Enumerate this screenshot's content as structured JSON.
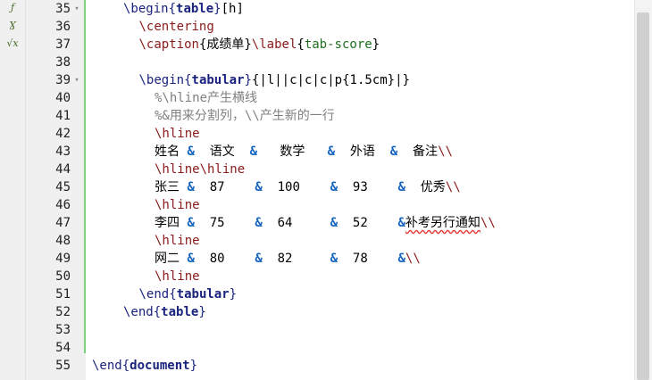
{
  "left_bar": {
    "icons": [
      {
        "name": "lambda-icon",
        "glyph": "ƒ"
      },
      {
        "name": "greek-icon",
        "glyph": "Ɣ"
      },
      {
        "name": "sqrt-icon",
        "glyph": "√x"
      }
    ]
  },
  "lines": [
    {
      "num": "35",
      "indent": 2,
      "fold": true,
      "tokens": [
        [
          "kw",
          "\\begin{"
        ],
        [
          "arg",
          "table"
        ],
        [
          "kw",
          "}"
        ],
        [
          "txt",
          "[h]"
        ]
      ]
    },
    {
      "num": "36",
      "indent": 3,
      "fold": false,
      "tokens": [
        [
          "cmd",
          "\\centering"
        ]
      ]
    },
    {
      "num": "37",
      "indent": 3,
      "fold": false,
      "tokens": [
        [
          "cmd",
          "\\caption"
        ],
        [
          "txt",
          "{成绩单}"
        ],
        [
          "cmd",
          "\\label"
        ],
        [
          "txt",
          "{"
        ],
        [
          "lbl",
          "tab-score"
        ],
        [
          "txt",
          "}"
        ]
      ]
    },
    {
      "num": "38",
      "indent": 0,
      "fold": false,
      "tokens": []
    },
    {
      "num": "39",
      "indent": 3,
      "fold": true,
      "tokens": [
        [
          "kw",
          "\\begin{"
        ],
        [
          "arg",
          "tabular"
        ],
        [
          "kw",
          "}"
        ],
        [
          "txt",
          "{|l||c|c|c|p{1.5cm}|}"
        ]
      ]
    },
    {
      "num": "40",
      "indent": 4,
      "fold": false,
      "tokens": [
        [
          "cmt",
          "%\\hline产生横线"
        ]
      ]
    },
    {
      "num": "41",
      "indent": 4,
      "fold": false,
      "tokens": [
        [
          "cmt",
          "%&用来分割列，\\\\产生新的一行"
        ]
      ]
    },
    {
      "num": "42",
      "indent": 4,
      "fold": false,
      "tokens": [
        [
          "cmd",
          "\\hline"
        ]
      ]
    },
    {
      "num": "43",
      "indent": 4,
      "fold": false,
      "tokens": [
        [
          "txt",
          "姓名 "
        ],
        [
          "amp",
          "&"
        ],
        [
          "txt",
          "  语文  "
        ],
        [
          "amp",
          "&"
        ],
        [
          "txt",
          "   数学   "
        ],
        [
          "amp",
          "&"
        ],
        [
          "txt",
          "  外语  "
        ],
        [
          "amp",
          "&"
        ],
        [
          "txt",
          "  备注"
        ],
        [
          "cmd",
          "\\\\"
        ]
      ]
    },
    {
      "num": "44",
      "indent": 4,
      "fold": false,
      "tokens": [
        [
          "cmd",
          "\\hline\\hline"
        ]
      ]
    },
    {
      "num": "45",
      "indent": 4,
      "fold": false,
      "tokens": [
        [
          "txt",
          "张三 "
        ],
        [
          "amp",
          "&"
        ],
        [
          "txt",
          "  87    "
        ],
        [
          "amp",
          "&"
        ],
        [
          "txt",
          "  100    "
        ],
        [
          "amp",
          "&"
        ],
        [
          "txt",
          "  93    "
        ],
        [
          "amp",
          "&"
        ],
        [
          "txt",
          "  优秀"
        ],
        [
          "cmd",
          "\\\\"
        ]
      ]
    },
    {
      "num": "46",
      "indent": 4,
      "fold": false,
      "tokens": [
        [
          "cmd",
          "\\hline"
        ]
      ]
    },
    {
      "num": "47",
      "indent": 4,
      "fold": false,
      "tokens": [
        [
          "txt",
          "李四 "
        ],
        [
          "amp",
          "&"
        ],
        [
          "txt",
          "  75    "
        ],
        [
          "amp",
          "&"
        ],
        [
          "txt",
          "  64     "
        ],
        [
          "amp",
          "&"
        ],
        [
          "txt",
          "  52    "
        ],
        [
          "amp",
          "&"
        ],
        [
          "sq",
          "补考另行通知"
        ],
        [
          "cmd",
          "\\\\"
        ]
      ]
    },
    {
      "num": "48",
      "indent": 4,
      "fold": false,
      "tokens": [
        [
          "cmd",
          "\\hline"
        ]
      ]
    },
    {
      "num": "49",
      "indent": 4,
      "fold": false,
      "tokens": [
        [
          "txt",
          "网二 "
        ],
        [
          "amp",
          "&"
        ],
        [
          "txt",
          "  80    "
        ],
        [
          "amp",
          "&"
        ],
        [
          "txt",
          "  82     "
        ],
        [
          "amp",
          "&"
        ],
        [
          "txt",
          "  78    "
        ],
        [
          "amp",
          "&"
        ],
        [
          "cmd",
          "\\\\"
        ]
      ]
    },
    {
      "num": "50",
      "indent": 4,
      "fold": false,
      "tokens": [
        [
          "cmd",
          "\\hline"
        ]
      ]
    },
    {
      "num": "51",
      "indent": 3,
      "fold": false,
      "tokens": [
        [
          "kw",
          "\\end{"
        ],
        [
          "arg",
          "tabular"
        ],
        [
          "kw",
          "}"
        ]
      ]
    },
    {
      "num": "52",
      "indent": 2,
      "fold": false,
      "tokens": [
        [
          "kw",
          "\\end{"
        ],
        [
          "arg",
          "table"
        ],
        [
          "kw",
          "}"
        ]
      ]
    },
    {
      "num": "53",
      "indent": 0,
      "fold": false,
      "tokens": []
    },
    {
      "num": "54",
      "indent": 0,
      "fold": false,
      "tokens": []
    },
    {
      "num": "55",
      "indent": 0,
      "fold": false,
      "tokens": [
        [
          "kw",
          "\\end{"
        ],
        [
          "arg",
          "document"
        ],
        [
          "kw",
          "}"
        ]
      ]
    }
  ]
}
